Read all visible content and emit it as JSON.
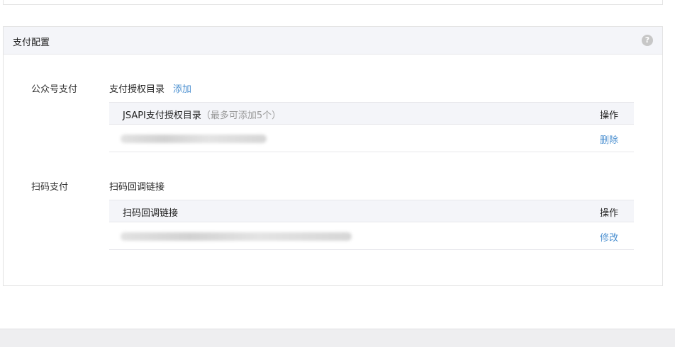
{
  "panel": {
    "title": "支付配置",
    "help_icon": "?"
  },
  "official_account_pay": {
    "label": "公众号支付",
    "section_title": "支付授权目录",
    "add_label": "添加",
    "table": {
      "col_main": "JSAPI支付授权目录",
      "col_main_hint": "（最多可添加5个）",
      "col_action": "操作"
    },
    "rows": [
      {
        "value": "",
        "action": "删除"
      }
    ]
  },
  "scan_pay": {
    "label": "扫码支付",
    "section_title": "扫码回调链接",
    "table": {
      "col_main": "扫码回调链接",
      "col_action": "操作"
    },
    "rows": [
      {
        "value": "",
        "action": "修改"
      }
    ]
  }
}
